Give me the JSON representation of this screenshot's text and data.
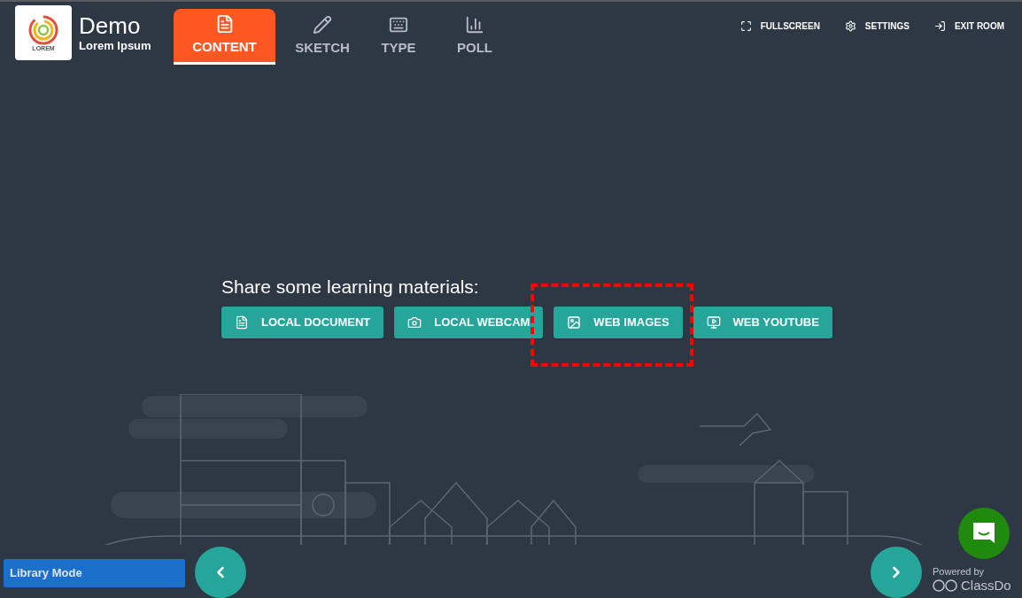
{
  "brand": {
    "logo_text": "LOREM",
    "title": "Demo",
    "subtitle": "Lorem Ipsum"
  },
  "tabs": [
    {
      "label": "CONTENT",
      "selected": true
    },
    {
      "label": "SKETCH",
      "selected": false
    },
    {
      "label": "TYPE",
      "selected": false
    },
    {
      "label": "POLL",
      "selected": false
    }
  ],
  "toolbar": [
    {
      "label": "FULLSCREEN"
    },
    {
      "label": "SETTINGS"
    },
    {
      "label": "EXIT ROOM"
    }
  ],
  "share": {
    "heading": "Share some learning materials:",
    "buttons": [
      {
        "label": "LOCAL DOCUMENT",
        "highlighted": false
      },
      {
        "label": "LOCAL WEBCAM",
        "highlighted": false
      },
      {
        "label": "WEB IMAGES",
        "highlighted": true
      },
      {
        "label": "WEB YOUTUBE",
        "highlighted": false
      }
    ]
  },
  "mode_badge": "Library Mode",
  "powered_by": {
    "caption": "Powered by",
    "brand": "ClassDo"
  }
}
